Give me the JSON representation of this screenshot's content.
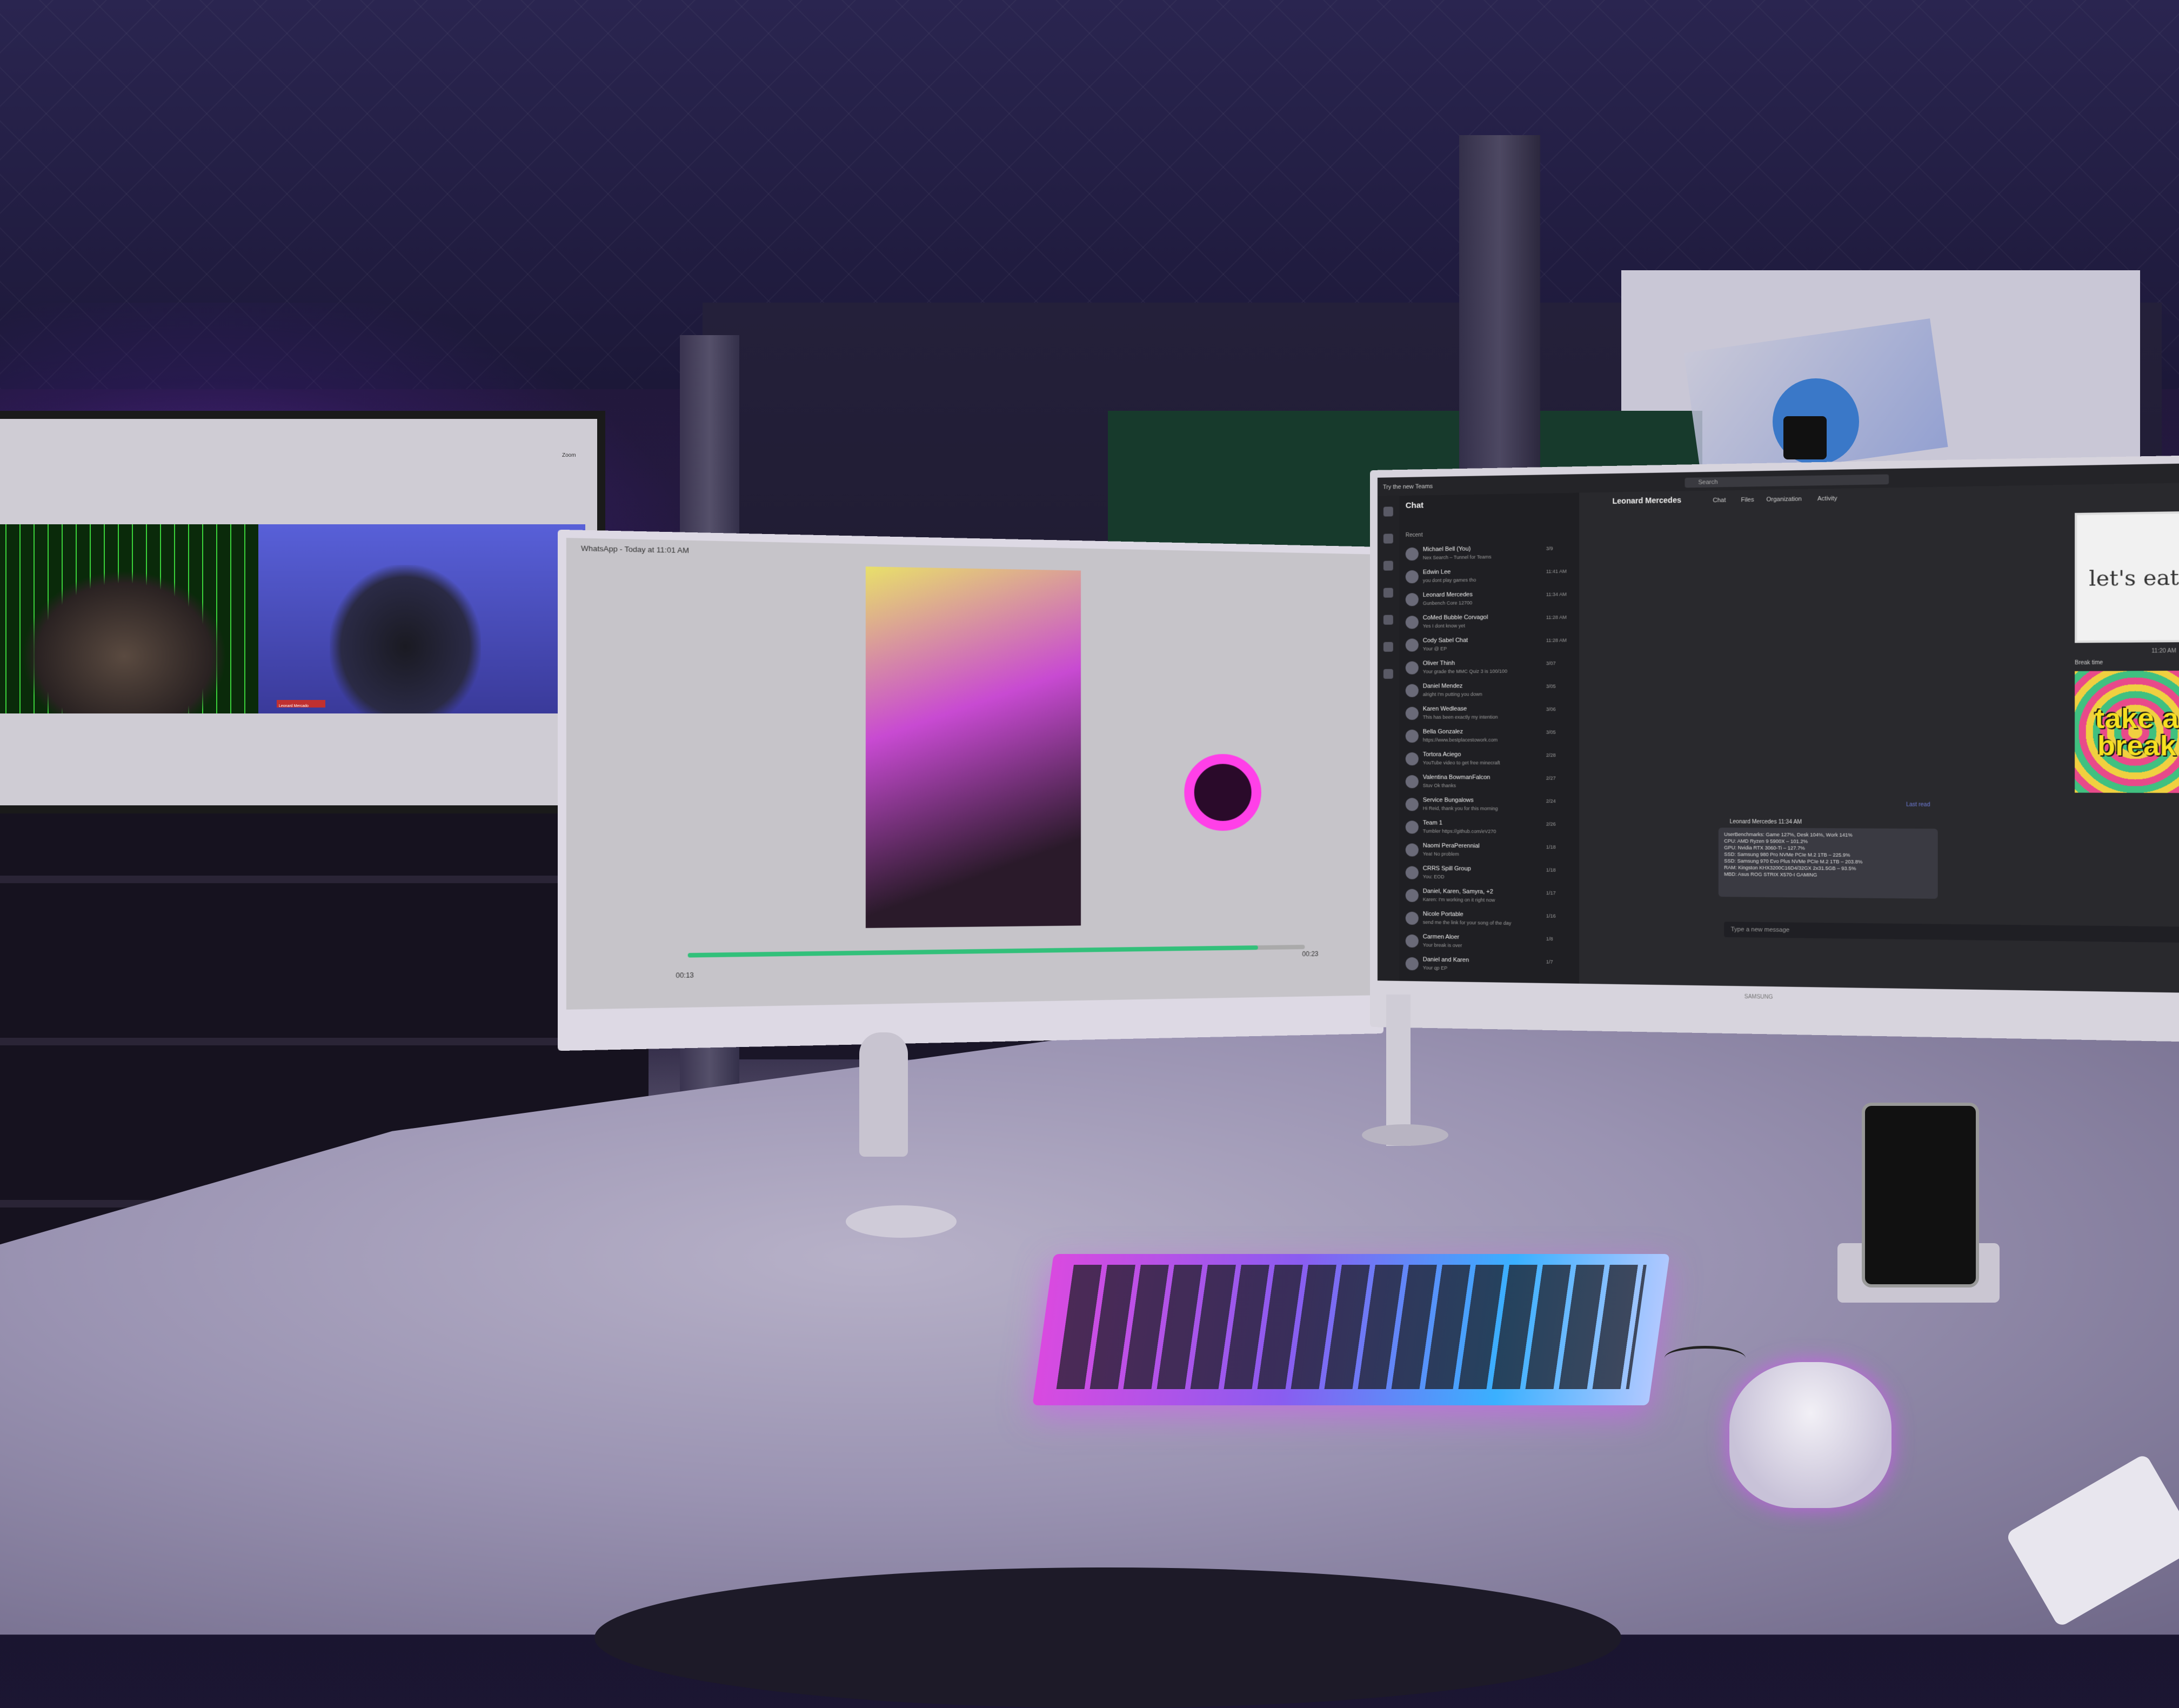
{
  "tv": {
    "title": "Zoom",
    "name_tag": "Leonard Mercado"
  },
  "left_monitor": {
    "window_title": "WhatsApp - Today at 11:01 AM",
    "time_elapsed": "00:13",
    "time_remaining": "00:23",
    "progress_fraction": 0.92
  },
  "right_monitor": {
    "top_bar": {
      "try_new": "Try the new Teams",
      "search_placeholder": "Search"
    },
    "chat_list": {
      "header": "Chat",
      "section": "Recent",
      "items": [
        {
          "name": "Michael Bell (You)",
          "preview": "Nex Search – Tunnel for Teams",
          "time": "3/9"
        },
        {
          "name": "Edwin Lee",
          "preview": "you dont play games tho",
          "time": "11:41 AM"
        },
        {
          "name": "Leonard Mercedes",
          "preview": "Gunbench Core 12700",
          "time": "11:34 AM"
        },
        {
          "name": "CoMed Bubble Corvagol",
          "preview": "Yes I dont know yet",
          "time": "11:28 AM"
        },
        {
          "name": "Cody Sabel Chat",
          "preview": "Your @ EP",
          "time": "11:28 AM"
        },
        {
          "name": "Oliver Thinh",
          "preview": "Your grade the MMC Quiz 3 is 100/100",
          "time": "3/07"
        },
        {
          "name": "Daniel Mendez",
          "preview": "alright I'm putting you down",
          "time": "3/05"
        },
        {
          "name": "Karen Wedlease",
          "preview": "This has been exactly my intention",
          "time": "3/06"
        },
        {
          "name": "Bella Gonzalez",
          "preview": "https://www.bestplacestowork.com",
          "time": "3/05"
        },
        {
          "name": "Tortora Aciego",
          "preview": "YouTube video to get free minecraft",
          "time": "2/28"
        },
        {
          "name": "Valentina BowmanFalcon",
          "preview": "Stuv Ok thanks",
          "time": "2/27"
        },
        {
          "name": "Service Bungalows",
          "preview": "Hi Reid, thank you for this morning",
          "time": "2/24"
        },
        {
          "name": "Team 1",
          "preview": "Tumbler https://github.com/eV270",
          "time": "2/26"
        },
        {
          "name": "Naomi PeraPerennial",
          "preview": "Yea! No problem",
          "time": "1/18"
        },
        {
          "name": "CRRS Spill Group",
          "preview": "You: EOD",
          "time": "1/18"
        },
        {
          "name": "Daniel, Karen, Samyra, +2",
          "preview": "Karen: I'm working on it right now",
          "time": "1/17"
        },
        {
          "name": "Nicole Portable",
          "preview": "send me the link for your song of the day",
          "time": "1/16"
        },
        {
          "name": "Carmen Aloer",
          "preview": "Your break is over",
          "time": "1/8"
        },
        {
          "name": "Daniel and Karen",
          "preview": "Your qp EP",
          "time": "1/7"
        }
      ]
    },
    "conversation": {
      "contact": "Leonard Mercedes",
      "tabs": [
        "Chat",
        "Files",
        "Organization",
        "Activity"
      ],
      "sticker_1_text": "let's eat",
      "sticker_time": "11:20 AM",
      "sticker_2_header": "Break time",
      "sticker_2_text": "take a break",
      "last_read": "Last read",
      "message_sender": "Leonard Mercedes 11:34 AM",
      "message_lines": [
        "UserBenchmarks: Game 127%, Desk 104%, Work 141%",
        "CPU: AMD Ryzen 9 5900X – 101.2%",
        "GPU: Nvidia RTX 3060-Ti – 127.7%",
        "SSD: Samsung 980 Pro NVMe PCIe M.2 1TB – 225.9%",
        "SSD: Samsung 970 Evo Plus NVMe PCIe M.2 1TB – 203.8%",
        "RAM: Kingston KHX3200C16D4/32GX 2x31.5GB – 93.5%",
        "MBD: Asus ROG STRIX X570-I GAMING"
      ],
      "compose_placeholder": "Type a new message"
    },
    "brand": "SAMSUNG"
  }
}
